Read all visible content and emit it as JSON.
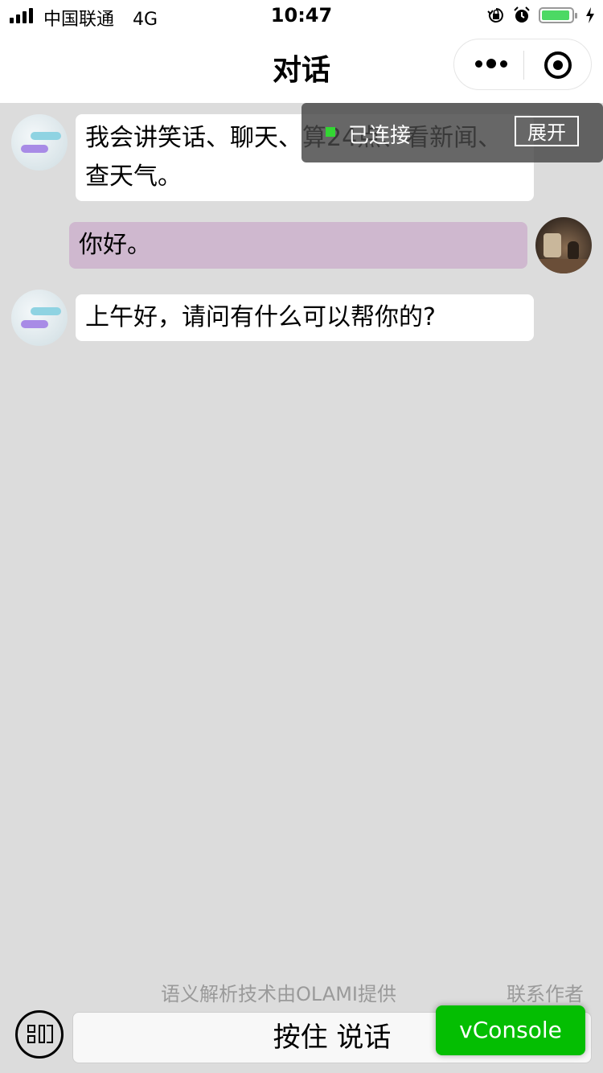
{
  "status_bar": {
    "carrier": "中国联通",
    "network": "4G",
    "time": "10:47",
    "battery_level": 0.85,
    "icons": [
      "orientation-lock-icon",
      "alarm-icon",
      "battery-icon",
      "charging-icon"
    ]
  },
  "nav": {
    "title": "对话",
    "icons": [
      "more-icon",
      "close-target-icon"
    ]
  },
  "messages": [
    {
      "from": "bot",
      "text": "我会讲笑话、聊天、算24点、看新闻、查天气。"
    },
    {
      "from": "user",
      "text": "你好。"
    },
    {
      "from": "bot",
      "text": "上午好，请问有什么可以帮你的?"
    }
  ],
  "vconsole_banner": {
    "status": "已连接",
    "expand_label": "展开",
    "status_color": "#33d633"
  },
  "footer": {
    "credit": "语义解析技术由OLAMI提供",
    "contact": "联系作者",
    "talk_button": "按住 说话",
    "vconsole_label": "vConsole",
    "vconsole_color": "#04be02"
  }
}
